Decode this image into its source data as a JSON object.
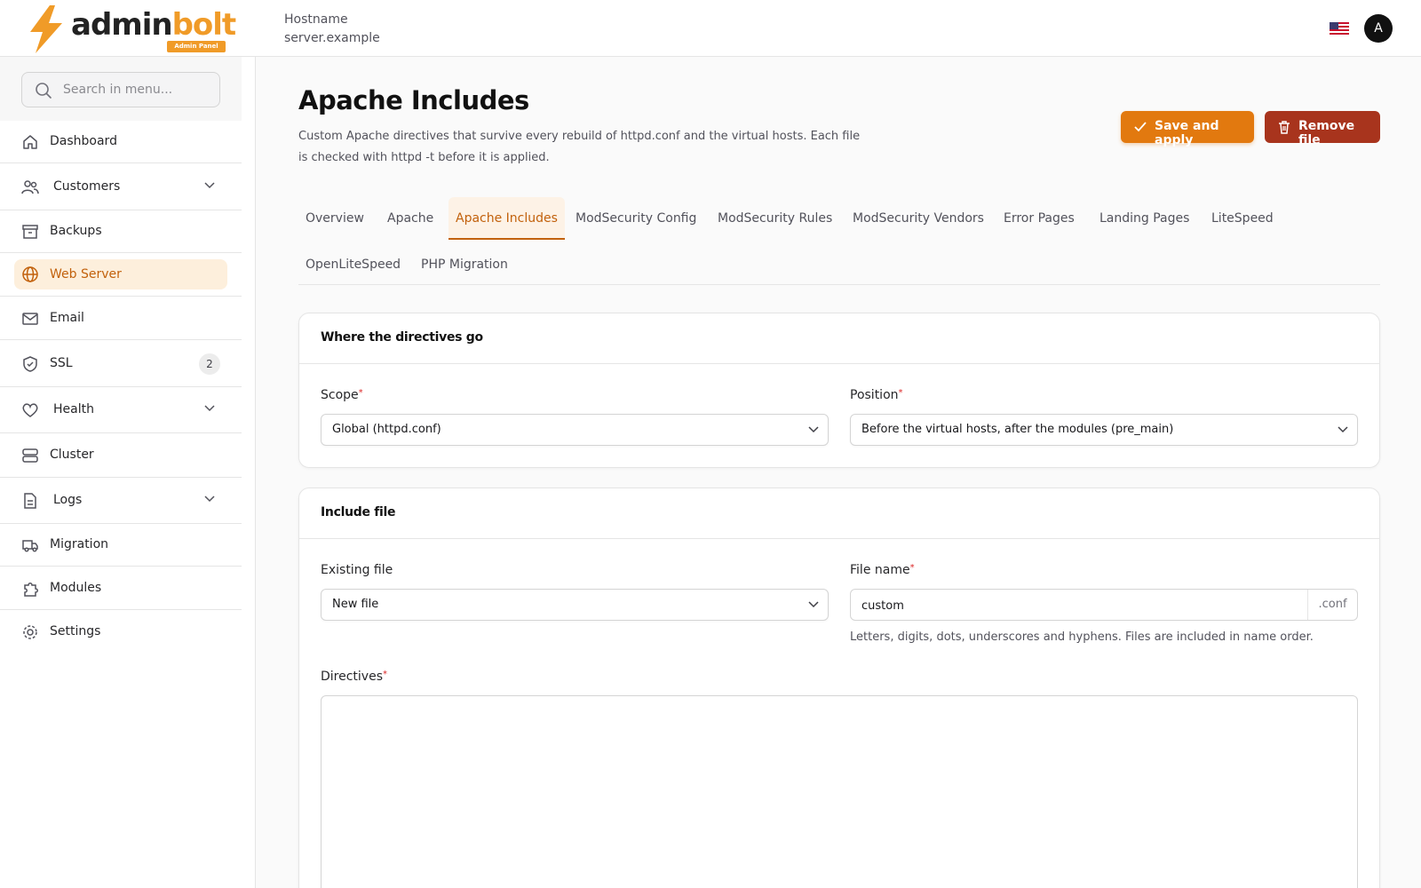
{
  "header": {
    "logo_main": "admin",
    "logo_accent": "bolt",
    "logo_badge": "Admin Panel",
    "hostname_label": "Hostname",
    "hostname_value": "server.example",
    "avatar_initial": "A"
  },
  "sidebar": {
    "search_placeholder": "Search in menu...",
    "items": [
      {
        "label": "Dashboard"
      },
      {
        "label": "Customers"
      },
      {
        "label": "Backups"
      },
      {
        "label": "Web Server"
      },
      {
        "label": "Email"
      },
      {
        "label": "SSL",
        "badge": "2"
      },
      {
        "label": "Health"
      },
      {
        "label": "Cluster"
      },
      {
        "label": "Logs"
      },
      {
        "label": "Migration"
      },
      {
        "label": "Modules"
      },
      {
        "label": "Settings"
      }
    ]
  },
  "page": {
    "title": "Apache Includes",
    "description": "Custom Apache directives that survive every rebuild of httpd.conf and the virtual hosts. Each file is checked with httpd -t before it is applied.",
    "save_label": "Save and apply",
    "remove_label": "Remove file"
  },
  "tabs": [
    "Overview",
    "Apache",
    "Apache Includes",
    "ModSecurity Config",
    "ModSecurity Rules",
    "ModSecurity Vendors",
    "Error Pages",
    "Landing Pages",
    "LiteSpeed",
    "OpenLiteSpeed",
    "PHP Migration"
  ],
  "placement": {
    "heading": "Where the directives go",
    "scope_label": "Scope",
    "scope_value": "Global (httpd.conf)",
    "position_label": "Position",
    "position_value": "Before the virtual hosts, after the modules (pre_main)"
  },
  "include_file": {
    "heading": "Include file",
    "existing_label": "Existing file",
    "existing_value": "New file",
    "filename_label": "File name",
    "filename_value": "custom",
    "filename_suffix": ".conf",
    "filename_hint": "Letters, digits, dots, underscores and hyphens. Files are included in name order.",
    "directives_label": "Directives",
    "directives_value": ""
  },
  "colors": {
    "accent": "#e2790f",
    "danger": "#a8341d",
    "active_bg": "#fdefdc"
  }
}
